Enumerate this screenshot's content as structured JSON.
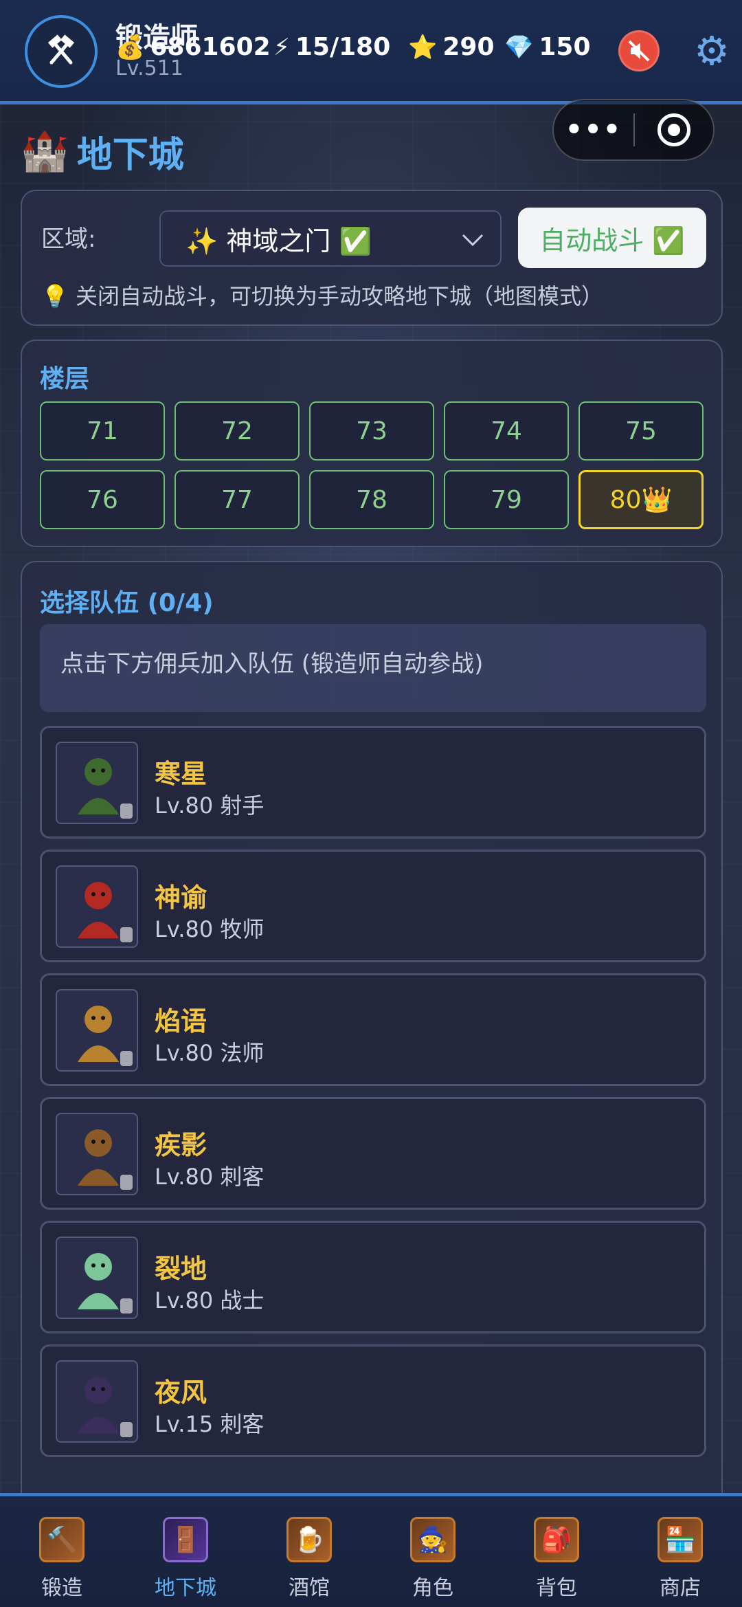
{
  "header": {
    "player_name": "锻造师",
    "player_level": "Lv.511",
    "gold": "6861602",
    "energy": "15/180",
    "stars": "290",
    "gems": "150"
  },
  "capsule": {
    "more_label": "•••"
  },
  "page": {
    "title": "地下城"
  },
  "zone": {
    "label": "区域:",
    "selected": "✨ 神域之门 ✅",
    "auto_battle_label": "自动战斗 ✅",
    "hint": "💡 关闭自动战斗，可切换为手动攻略地下城（地图模式）"
  },
  "floors": {
    "title": "楼层",
    "items": [
      "71",
      "72",
      "73",
      "74",
      "75",
      "76",
      "77",
      "78",
      "79",
      "80👑"
    ],
    "selected": "80👑"
  },
  "team": {
    "title": "选择队伍 (0/4)",
    "empty_hint": "点击下方佣兵加入队伍 (锻造师自动参战)",
    "mercenaries": [
      {
        "name": "寒星",
        "sub": "Lv.80 射手",
        "portrait": "orc-archer-portrait",
        "color": "#3f6b2e"
      },
      {
        "name": "神谕",
        "sub": "Lv.80 牧师",
        "portrait": "red-priestess-portrait",
        "color": "#b32a22"
      },
      {
        "name": "焰语",
        "sub": "Lv.80 法师",
        "portrait": "dwarf-mage-portrait",
        "color": "#b9822e"
      },
      {
        "name": "疾影",
        "sub": "Lv.80 刺客",
        "portrait": "hooded-assassin-portrait",
        "color": "#8a5a2a"
      },
      {
        "name": "裂地",
        "sub": "Lv.80 战士",
        "portrait": "elf-warrior-portrait",
        "color": "#7cc69a"
      },
      {
        "name": "夜风",
        "sub": "Lv.15 刺客",
        "portrait": "ninja-assassin-portrait",
        "color": "#3b2e5c"
      }
    ]
  },
  "nav": {
    "items": [
      {
        "label": "锻造",
        "icon": "forge-icon",
        "glyph": "🔨"
      },
      {
        "label": "地下城",
        "icon": "dungeon-icon",
        "glyph": "🚪"
      },
      {
        "label": "酒馆",
        "icon": "tavern-icon",
        "glyph": "🍺"
      },
      {
        "label": "角色",
        "icon": "character-icon",
        "glyph": "🧙"
      },
      {
        "label": "背包",
        "icon": "backpack-icon",
        "glyph": "🎒"
      },
      {
        "label": "商店",
        "icon": "shop-icon",
        "glyph": "🏪"
      }
    ],
    "active": "地下城"
  },
  "colors": {
    "accent_blue": "#5fb0f2",
    "gold_text": "#f2c542",
    "floor_green": "#6cc070",
    "floor_selected": "#f4d32a",
    "auto_green": "#4caf63"
  }
}
